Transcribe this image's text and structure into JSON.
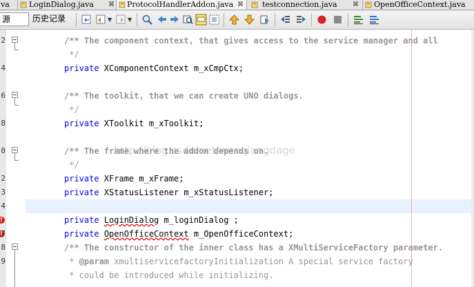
{
  "tabs": [
    {
      "label": "va",
      "close": "",
      "active": false,
      "name": "tab-partial"
    },
    {
      "label": "LoginDialog.java",
      "close": "⌘",
      "active": false,
      "name": "tab-logindialog"
    },
    {
      "label": "ProtocolHandlerAddon.java",
      "close": "⌘",
      "active": true,
      "name": "tab-protocolhandleraddon"
    },
    {
      "label": "testconnection.java",
      "close": "⌘",
      "active": false,
      "name": "tab-testconnection"
    },
    {
      "label": "OpenOfficeContext.java",
      "close": "",
      "active": false,
      "name": "tab-openofficecontext"
    }
  ],
  "toolbar": {
    "source_label": "源",
    "history_label": "历史记录"
  },
  "watermark": "http://blog.csdn.net/wenqiangdage",
  "code_lines": [
    {
      "num": "2",
      "text": "/** The component context, that gives access to the service manager and all"
    },
    {
      "num": "",
      "text": " */"
    },
    {
      "num": "4",
      "text": "private XComponentContext m_xCmpCtx;"
    },
    {
      "num": "",
      "text": ""
    },
    {
      "num": "6",
      "text": "/** The toolkit, that we can create UNO dialogs."
    },
    {
      "num": "",
      "text": " */"
    },
    {
      "num": "8",
      "text": "private XToolkit m_xToolkit;"
    },
    {
      "num": "",
      "text": ""
    },
    {
      "num": "0",
      "text": "/** The frame where the addon depends on."
    },
    {
      "num": "",
      "text": " */"
    },
    {
      "num": "2",
      "text": "private XFrame m_xFrame;"
    },
    {
      "num": "3",
      "text": "private XStatusListener m_xStatusListener;"
    },
    {
      "num": "4",
      "text": ""
    },
    {
      "num": "",
      "text": "private LoginDialog m_loginDialog ;"
    },
    {
      "num": "7",
      "text": "private OpenOfficeContext m_OpenOfficeContext;"
    },
    {
      "num": "8",
      "text": "/** The constructor of the inner class has a XMultiServiceFactory parameter."
    },
    {
      "num": "9",
      "text": " * @param xmultiservicefactoryInitialization A special service factory"
    },
    {
      "num": "",
      "text": " * could be introduced while initializing."
    }
  ]
}
